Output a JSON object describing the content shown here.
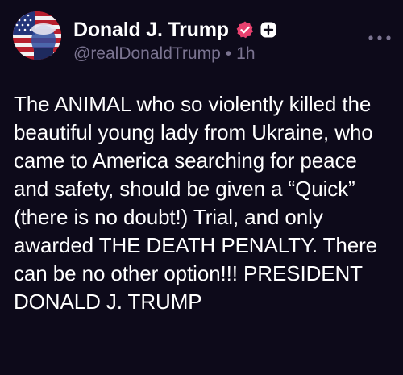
{
  "post": {
    "author": {
      "display_name": "Donald J. Trump",
      "handle": "@realDonaldTrump",
      "time_ago": "1h",
      "separator": "•",
      "verified": true,
      "avatar_icon": "flag-portrait-avatar"
    },
    "text": "The ANIMAL who so violently killed the beautiful young lady from Ukraine, who came to America searching for peace and safety, should be given a “Quick” (there is no doubt!) Trial, and only awarded THE DEATH PENALTY. There can be no other option!!! PRESIDENT DONALD J. TRUMP"
  },
  "icons": {
    "verified": "verified-badge-icon",
    "plus": "plus-badge-icon",
    "more": "more-options-icon"
  },
  "colors": {
    "background": "#0d0a1a",
    "verified_badge": "#e8416f",
    "secondary_text": "#7a7390"
  }
}
